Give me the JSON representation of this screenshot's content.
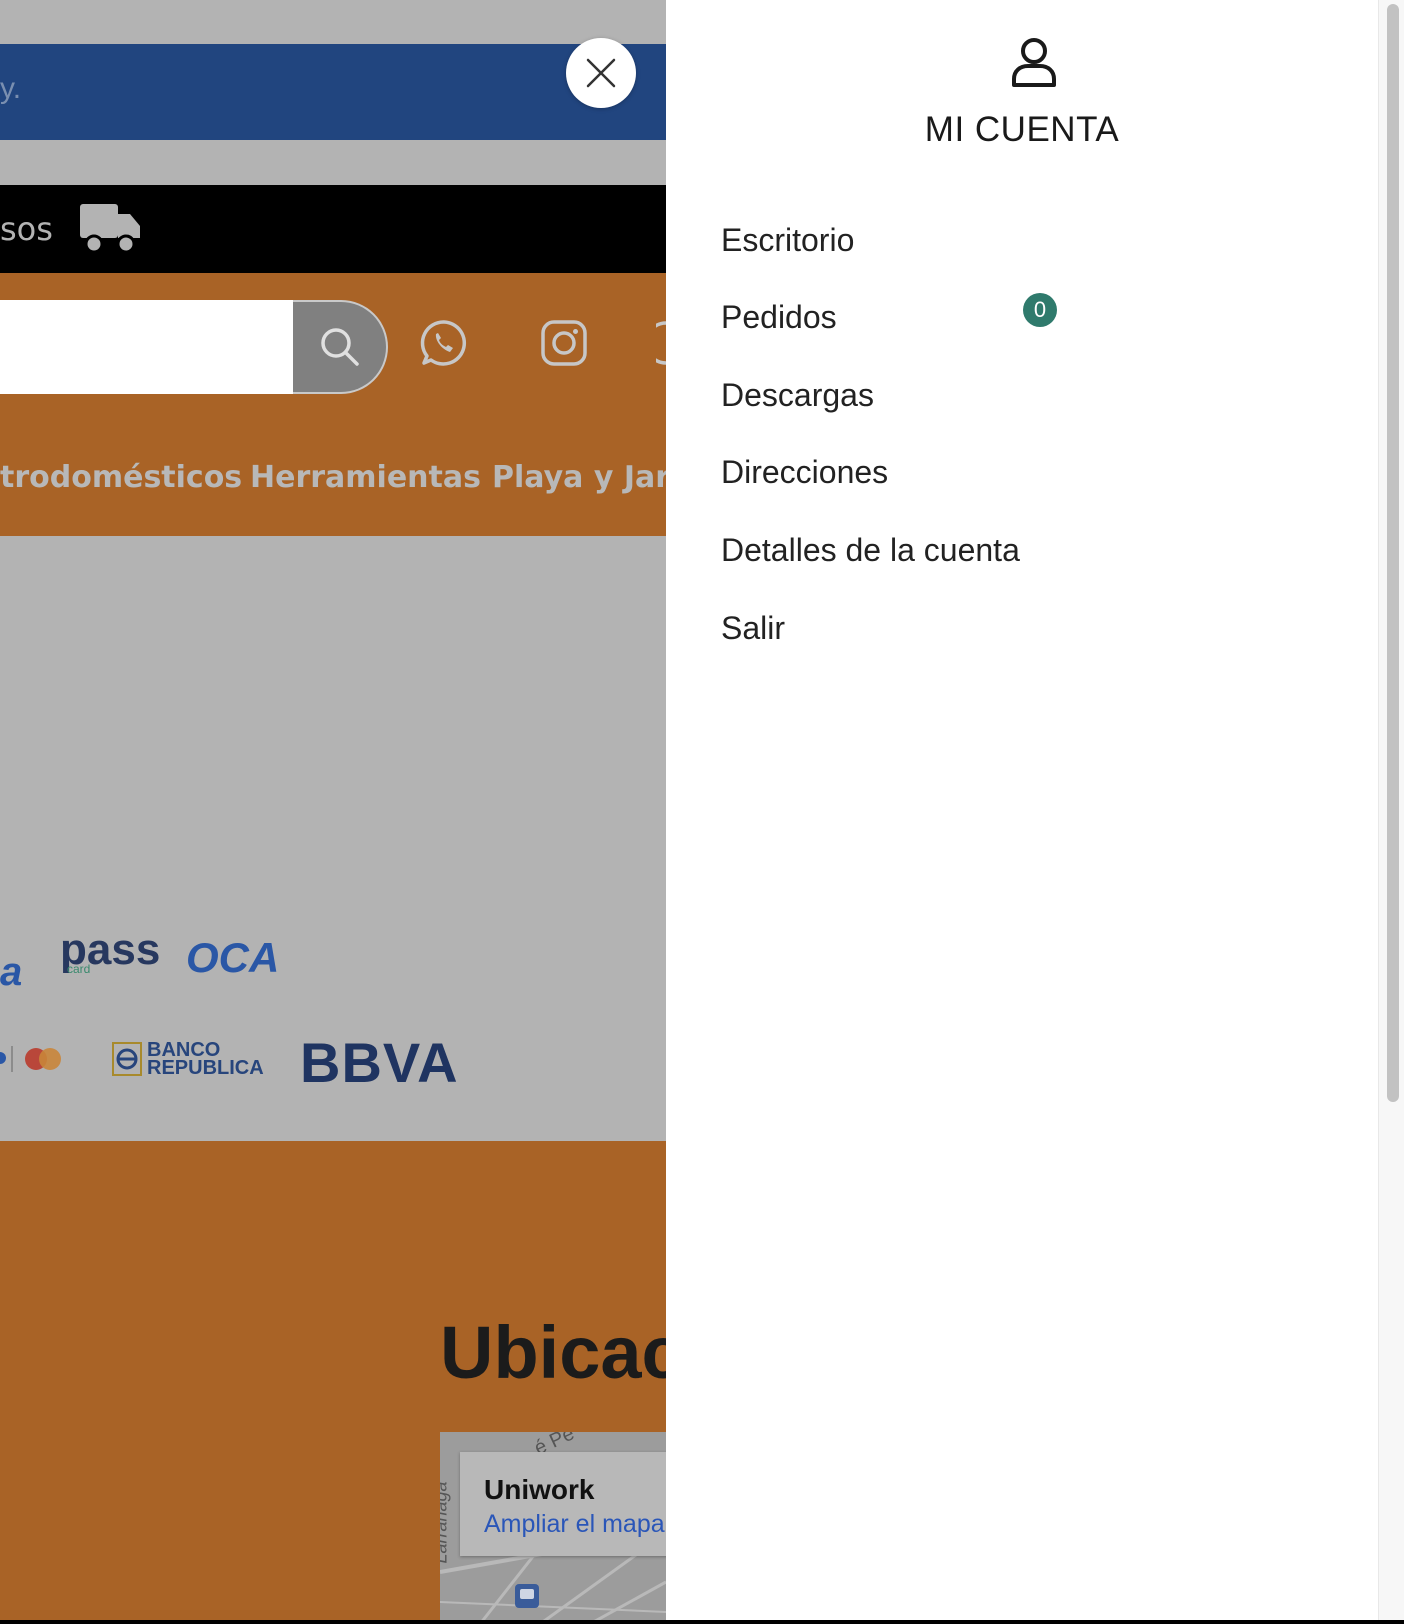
{
  "background_page": {
    "promo_text_fragment": "y.",
    "shipping_text_fragment": "sos",
    "search": {
      "placeholder": ""
    },
    "nav_links": [
      "trodomésticos",
      "Herramientas",
      "Playa y Jard"
    ],
    "payment_logos": [
      "a",
      "pass",
      "card",
      "OCA",
      "BANCO",
      "REPUBLICA",
      "BBVA"
    ],
    "section_title_fragment": "Ubicac",
    "map": {
      "place_name": "Uniwork",
      "link_text": "Ampliar el mapa",
      "street_fragment_1": "Larrañaga",
      "street_fragment_2": "é Pe"
    }
  },
  "account_panel": {
    "title": "MI CUENTA",
    "menu": [
      {
        "label": "Escritorio"
      },
      {
        "label": "Pedidos",
        "badge": "0"
      },
      {
        "label": "Descargas"
      },
      {
        "label": "Direcciones"
      },
      {
        "label": "Detalles de la cuenta"
      },
      {
        "label": "Salir"
      }
    ]
  },
  "icons": {
    "close": "close-icon",
    "account": "user-icon",
    "search": "search-icon",
    "whatsapp": "whatsapp-icon",
    "instagram": "instagram-icon",
    "truck": "truck-icon"
  },
  "colors": {
    "promo_bar": "#21457f",
    "orange": "#a96326",
    "badge": "#2f7a6c",
    "overlay_grey": "#b3b3b3"
  }
}
